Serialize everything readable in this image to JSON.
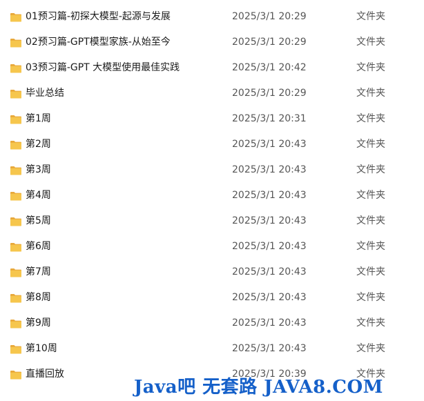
{
  "files": [
    {
      "name": "01预习篇-初探大模型-起源与发展",
      "modified": "2025/3/1 20:29",
      "type": "文件夹",
      "icon": "folder-icon"
    },
    {
      "name": "02预习篇-GPT模型家族-从始至今",
      "modified": "2025/3/1 20:29",
      "type": "文件夹",
      "icon": "folder-icon"
    },
    {
      "name": "03预习篇-GPT 大模型使用最佳实践",
      "modified": "2025/3/1 20:42",
      "type": "文件夹",
      "icon": "folder-icon"
    },
    {
      "name": "毕业总结",
      "modified": "2025/3/1 20:29",
      "type": "文件夹",
      "icon": "folder-icon"
    },
    {
      "name": "第1周",
      "modified": "2025/3/1 20:31",
      "type": "文件夹",
      "icon": "folder-icon"
    },
    {
      "name": "第2周",
      "modified": "2025/3/1 20:43",
      "type": "文件夹",
      "icon": "folder-icon"
    },
    {
      "name": "第3周",
      "modified": "2025/3/1 20:43",
      "type": "文件夹",
      "icon": "folder-icon"
    },
    {
      "name": "第4周",
      "modified": "2025/3/1 20:43",
      "type": "文件夹",
      "icon": "folder-icon"
    },
    {
      "name": "第5周",
      "modified": "2025/3/1 20:43",
      "type": "文件夹",
      "icon": "folder-icon"
    },
    {
      "name": "第6周",
      "modified": "2025/3/1 20:43",
      "type": "文件夹",
      "icon": "folder-icon"
    },
    {
      "name": "第7周",
      "modified": "2025/3/1 20:43",
      "type": "文件夹",
      "icon": "folder-icon"
    },
    {
      "name": "第8周",
      "modified": "2025/3/1 20:43",
      "type": "文件夹",
      "icon": "folder-icon"
    },
    {
      "name": "第9周",
      "modified": "2025/3/1 20:43",
      "type": "文件夹",
      "icon": "folder-icon"
    },
    {
      "name": "第10周",
      "modified": "2025/3/1 20:43",
      "type": "文件夹",
      "icon": "folder-icon"
    },
    {
      "name": "直播回放",
      "modified": "2025/3/1 20:39",
      "type": "文件夹",
      "icon": "folder-icon"
    }
  ],
  "watermark": {
    "text": "Java吧 无套路 JAVA8.COM",
    "color": "#1560c9"
  },
  "colors": {
    "folder_back": "#e8a83a",
    "folder_front": "#f6c64d",
    "secondary_text": "#555555"
  }
}
